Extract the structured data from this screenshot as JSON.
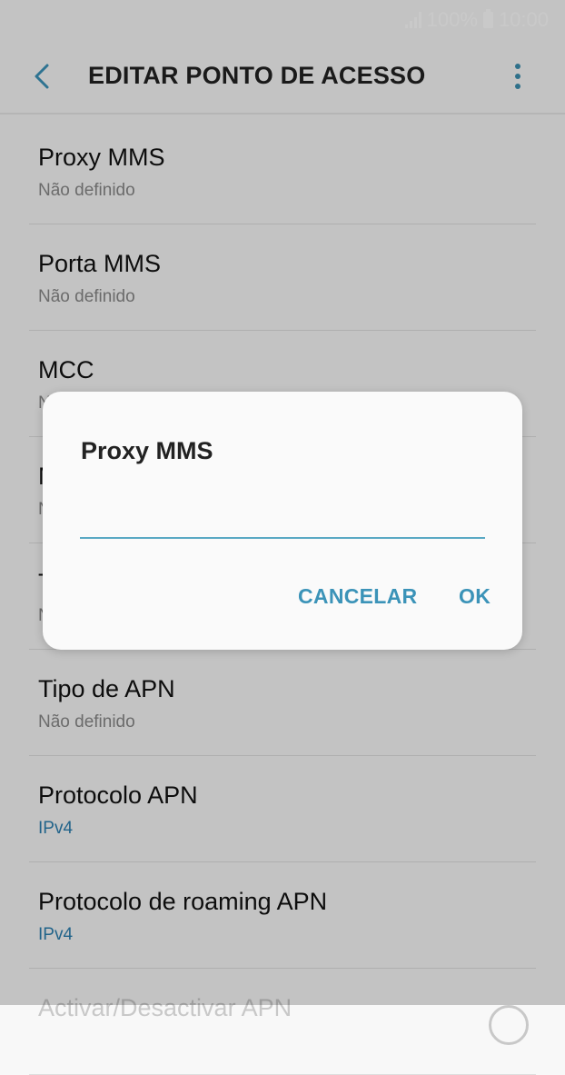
{
  "status_bar": {
    "battery": "100%",
    "time": "10:00"
  },
  "app_bar": {
    "title": "EDITAR PONTO DE ACESSO"
  },
  "settings": [
    {
      "title": "Proxy MMS",
      "value": "Não definido",
      "accent": false,
      "dim": false
    },
    {
      "title": "Porta MMS",
      "value": "Não definido",
      "accent": false,
      "dim": false
    },
    {
      "title": "MCC",
      "value": "Não definido",
      "accent": false,
      "dim": false
    },
    {
      "title": "MNC",
      "value": "Não definido",
      "accent": false,
      "dim": false
    },
    {
      "title": "Tipo de autenticação",
      "value": "Nenhum",
      "accent": false,
      "dim": false
    },
    {
      "title": "Tipo de APN",
      "value": "Não definido",
      "accent": false,
      "dim": false
    },
    {
      "title": "Protocolo APN",
      "value": "IPv4",
      "accent": true,
      "dim": false
    },
    {
      "title": "Protocolo de roaming APN",
      "value": "IPv4",
      "accent": true,
      "dim": false
    },
    {
      "title": "Activar/Desactivar APN",
      "value": "",
      "accent": false,
      "dim": true
    }
  ],
  "dialog": {
    "title": "Proxy MMS",
    "input_value": "",
    "cancel_label": "CANCELAR",
    "ok_label": "OK"
  },
  "colors": {
    "accent": "#3b93b8",
    "value_blue": "#2c7fb0"
  }
}
